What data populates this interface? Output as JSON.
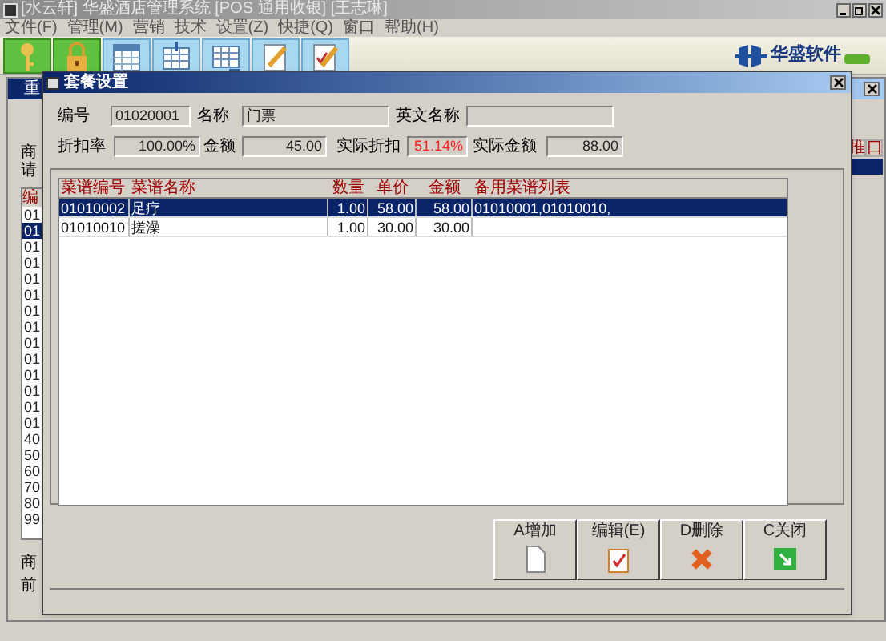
{
  "window": {
    "title": "[水云轩] 华盛酒店管理系统 [POS 通用收银] [王志琳]"
  },
  "menu": [
    "文件(F)",
    "管理(M)",
    "营销",
    "技术",
    "设置(Z)",
    "快捷(Q)",
    "窗口",
    "帮助(H)"
  ],
  "toolbar": [
    {
      "kind": "key",
      "highlighted": true
    },
    {
      "kind": "lock",
      "highlighted": true
    },
    {
      "kind": "calendar",
      "highlighted": false
    },
    {
      "kind": "grid-in",
      "highlighted": false
    },
    {
      "kind": "grid-out",
      "highlighted": false
    },
    {
      "kind": "pencil",
      "highlighted": false
    },
    {
      "kind": "pencil-check",
      "highlighted": false
    }
  ],
  "logo": {
    "name": "华盛软件"
  },
  "background_window": {
    "title": "重",
    "labels": [
      "商",
      "请"
    ],
    "list_header": "编",
    "list_rows": [
      {
        "code": "01",
        "selected": false
      },
      {
        "code": "01",
        "selected": true
      },
      {
        "code": "01",
        "selected": false
      },
      {
        "code": "01",
        "selected": false
      },
      {
        "code": "01",
        "selected": false
      },
      {
        "code": "01",
        "selected": false
      },
      {
        "code": "01",
        "selected": false
      },
      {
        "code": "01",
        "selected": false
      },
      {
        "code": "01",
        "selected": false
      },
      {
        "code": "01",
        "selected": false
      },
      {
        "code": "01",
        "selected": false
      },
      {
        "code": "01",
        "selected": false
      },
      {
        "code": "01",
        "selected": false
      },
      {
        "code": "01",
        "selected": false
      },
      {
        "code": "40",
        "selected": false
      },
      {
        "code": "50",
        "selected": false
      },
      {
        "code": "60",
        "selected": false
      },
      {
        "code": "70",
        "selected": false
      },
      {
        "code": "80",
        "selected": false
      },
      {
        "code": "99",
        "selected": false
      }
    ],
    "bottom_labels": [
      "商",
      "前"
    ],
    "right_headers": [
      "推",
      "口"
    ]
  },
  "dialog": {
    "title": "套餐设置",
    "fields": [
      {
        "label": "编号",
        "value": "01020001",
        "emphasis": false
      },
      {
        "label": "名称",
        "value": "门票",
        "emphasis": false
      },
      {
        "label": "英文名称"
      },
      {
        "label": "折扣率",
        "value": "100.00%",
        "emphasis": false
      },
      {
        "label": "金额",
        "value": "45.00",
        "emphasis": false
      },
      {
        "label": "实际折扣",
        "value": "51.14%",
        "emphasis": true
      },
      {
        "label": "实际金额",
        "value": "88.00",
        "emphasis": false
      }
    ],
    "table": {
      "columns": [
        "菜谱编号",
        "菜谱名称",
        "数量",
        "单价",
        "金额",
        "备用菜谱列表"
      ],
      "rows": [
        {
          "cells": [
            "01010002",
            "足疗",
            "1.00",
            "58.00",
            "58.00",
            "01010001,01010010,"
          ],
          "selected": true
        },
        {
          "cells": [
            "01010010",
            "搓澡",
            "1.00",
            "30.00",
            "30.00"
          ],
          "selected": false
        }
      ]
    },
    "buttons": [
      {
        "label": "A增加",
        "kind": "new"
      },
      {
        "label": "编辑(E)",
        "kind": "edit"
      },
      {
        "label": "D删除",
        "kind": "delete"
      },
      {
        "label": "C关闭",
        "kind": "close"
      }
    ]
  }
}
